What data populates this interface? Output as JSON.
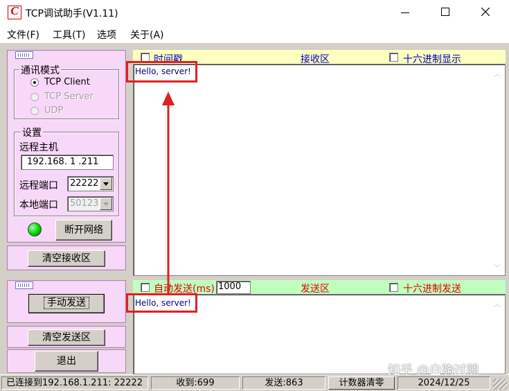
{
  "window": {
    "title": "TCP调试助手(V1.11)",
    "icon_glyph": "C",
    "controls": [
      "minimize",
      "maximize",
      "close"
    ]
  },
  "menu": [
    "文件(F)",
    "工具(T)",
    "选项",
    "关于(A)"
  ],
  "left": {
    "comm_mode": {
      "title": "通讯模式",
      "options": [
        {
          "label": "TCP Client",
          "selected": true,
          "enabled": true
        },
        {
          "label": "TCP Server",
          "selected": false,
          "enabled": false
        },
        {
          "label": "UDP",
          "selected": false,
          "enabled": false
        }
      ]
    },
    "settings": {
      "title": "设置",
      "remote_host_label": "远程主机",
      "remote_host_value": "192.168. 1 .211",
      "remote_port_label": "远程端口",
      "remote_port_value": "22222",
      "local_port_label": "本地端口",
      "local_port_value": "50123"
    },
    "connection_led_color": "#00d000",
    "disconnect_button": "断开网络",
    "clear_receive_button": "清空接收区",
    "manual_send_button": "手动发送",
    "clear_send_button": "清空发送区",
    "exit_button": "退出"
  },
  "receive": {
    "timestamp_label": "时间戳",
    "title": "接收区",
    "hex_display_label": "十六进制显示",
    "content": "Hello, server!"
  },
  "send": {
    "auto_send_label": "自动发送(ms)",
    "interval_value": "1000",
    "title": "发送区",
    "hex_send_label": "十六进制发送",
    "content": "Hello, server!"
  },
  "status": {
    "connected": "已连接到192.168.1.211:  22222",
    "received": "收到:699",
    "sent": "发送:863",
    "reset_counter": "计数器清零",
    "date": "2024/12/25"
  },
  "watermark": "知乎 @白驹过隙",
  "colors": {
    "panel_pink": "#f8d8f8",
    "receive_header": "#ffffc0",
    "send_header": "#c0ffc0",
    "annotation_red": "#e02020"
  }
}
